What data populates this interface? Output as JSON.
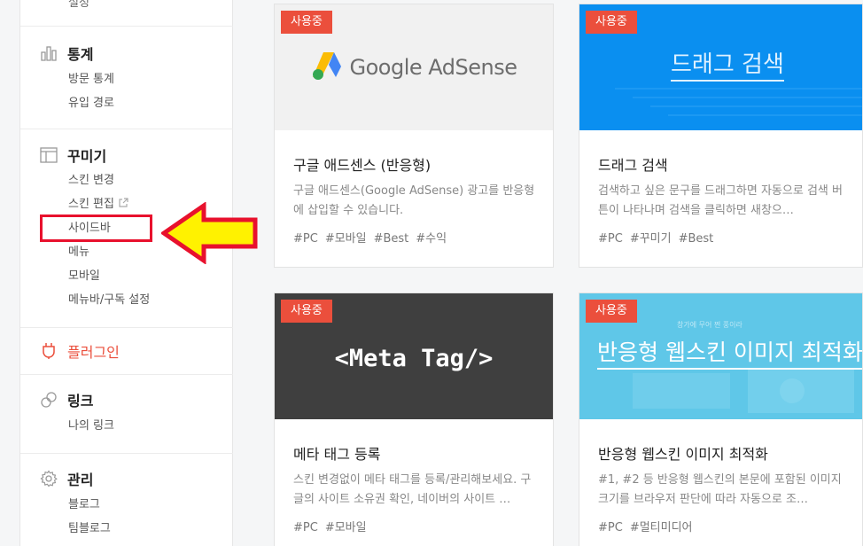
{
  "sidebar": {
    "top_stub": "설정",
    "stats": {
      "title": "통계",
      "items": [
        "방문 통계",
        "유입 경로"
      ]
    },
    "decorate": {
      "title": "꾸미기",
      "items": [
        "스킨 변경",
        "스킨 편집",
        "사이드바",
        "메뉴",
        "모바일",
        "메뉴바/구독 설정"
      ]
    },
    "plugin": {
      "title": "플러그인"
    },
    "link": {
      "title": "링크",
      "items": [
        "나의 링크"
      ]
    },
    "manage": {
      "title": "관리",
      "items": [
        "블로그",
        "팀블로그"
      ]
    }
  },
  "cards": [
    {
      "badge": "사용중",
      "thumb_text": "Google AdSense",
      "title": "구글 애드센스 (반응형)",
      "desc": "구글 애드센스(Google AdSense) 광고를 반응형에 삽입할 수 있습니다.",
      "tags": [
        "#PC",
        "#모바일",
        "#Best",
        "#수익"
      ]
    },
    {
      "badge": "사용중",
      "thumb_text": "드래그 검색",
      "title": "드래그 검색",
      "desc": "검색하고 싶은 문구를 드래그하면 자동으로 검색 버튼이 나타나며 검색을 클릭하면 새창으…",
      "tags": [
        "#PC",
        "#꾸미기",
        "#Best"
      ]
    },
    {
      "badge": "사용중",
      "thumb_text": "<Meta Tag/>",
      "title": "메타 태그 등록",
      "desc": "스킨 변경없이 메타 태그를 등록/관리해보세요. 구글의 사이트 소유권 확인, 네이버의 사이트 …",
      "tags": [
        "#PC",
        "#모바일"
      ]
    },
    {
      "badge": "사용중",
      "thumb_text": "반응형 웹스킨 이미지 최적화",
      "thumb_small": "창가에 무어 쩐 풍이라",
      "title": "반응형 웹스킨 이미지 최적화",
      "desc": "#1, #2 등 반응형 웹스킨의 본문에 포함된 이미지 크기를 브라우저 판단에 따라 자동으로 조…",
      "tags": [
        "#PC",
        "#멀티미디어"
      ]
    }
  ],
  "colors": {
    "accent": "#eb4f3c",
    "highlight": "#e8112d",
    "arrow_fill": "#fff200"
  }
}
